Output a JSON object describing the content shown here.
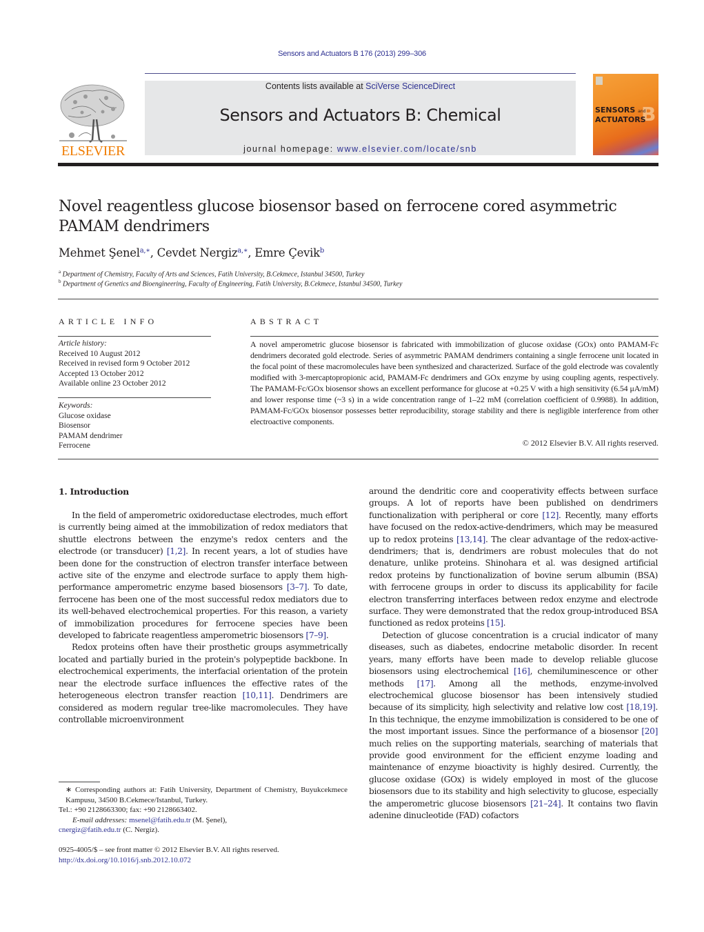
{
  "running_head": "Sensors and Actuators B 176 (2013) 299–306",
  "masthead": {
    "publisher_logo_text": "ELSEVIER",
    "contents_prefix": "Contents lists available at ",
    "contents_link": "SciVerse ScienceDirect",
    "journal_title": "Sensors and Actuators B: Chemical",
    "homepage_prefix": "journal homepage: ",
    "homepage_link": "www.elsevier.com/locate/snb",
    "cover_line1": "SENSORS",
    "cover_and": "and",
    "cover_line2": "ACTUATORS",
    "cover_letter": "B",
    "colors": {
      "publisher_orange": "#f07c00",
      "link_blue": "#2e3192",
      "masthead_gray": "#e6e7e8"
    }
  },
  "article": {
    "title": "Novel reagentless glucose biosensor based on ferrocene cored asymmetric PAMAM dendrimers",
    "authors": [
      {
        "name": "Mehmet Şenel",
        "sup": "a,∗",
        "sep": ", "
      },
      {
        "name": "Cevdet Nergiz",
        "sup": "a,∗",
        "sep": ", "
      },
      {
        "name": "Emre Çevik",
        "sup": "b",
        "sep": ""
      }
    ],
    "affiliations": [
      {
        "mark": "a",
        "text": "Department of Chemistry, Faculty of Arts and Sciences, Fatih University, B.Cekmece, Istanbul 34500, Turkey"
      },
      {
        "mark": "b",
        "text": "Department of Genetics and Bioengineering, Faculty of Engineering, Fatih University, B.Cekmece, Istanbul 34500, Turkey"
      }
    ]
  },
  "article_info": {
    "heading": "ARTICLE INFO",
    "history_label": "Article history:",
    "history": [
      "Received 10 August 2012",
      "Received in revised form 9 October 2012",
      "Accepted 13 October 2012",
      "Available online 23 October 2012"
    ],
    "keywords_label": "Keywords:",
    "keywords": [
      "Glucose oxidase",
      "Biosensor",
      "PAMAM dendrimer",
      "Ferrocene"
    ]
  },
  "abstract": {
    "heading": "ABSTRACT",
    "text": "A novel amperometric glucose biosensor is fabricated with immobilization of glucose oxidase (GOx) onto PAMAM-Fc dendrimers decorated gold electrode. Series of asymmetric PAMAM dendrimers containing a single ferrocene unit located in the focal point of these macromolecules have been synthesized and characterized. Surface of the gold electrode was covalently modified with 3-mercaptopropionic acid, PAMAM-Fc dendrimers and GOx enzyme by using coupling agents, respectively. The PAMAM-Fc/GOx biosensor shows an excellent performance for glucose at +0.25 V with a high sensitivity (6.54 μA/mM) and lower response time (~3 s) in a wide concentration range of 1–22 mM (correlation coefficient of 0.9988). In addition, PAMAM-Fc/GOx biosensor possesses better reproducibility, storage stability and there is negligible interference from other electroactive components.",
    "copyright": "© 2012 Elsevier B.V. All rights reserved."
  },
  "body": {
    "section_heading": "1.  Introduction",
    "left_paragraphs": [
      [
        {
          "t": "In the field of amperometric oxidoreductase electrodes, much effort is currently being aimed at the immobilization of redox mediators that shuttle electrons between the enzyme's redox centers and the electrode (or transducer) "
        },
        {
          "ref": "[1,2]"
        },
        {
          "t": ". In recent years, a lot of studies have been done for the construction of electron transfer interface between active site of the enzyme and electrode surface to apply them high-performance amperometric enzyme based biosensors "
        },
        {
          "ref": "[3–7]"
        },
        {
          "t": ". To date, ferrocene has been one of the most successful redox mediators due to its well-behaved electrochemical properties. For this reason, a variety of immobilization procedures for ferrocene species have been developed to fabricate reagentless amperometric biosensors "
        },
        {
          "ref": "[7–9]"
        },
        {
          "t": "."
        }
      ],
      [
        {
          "t": "Redox proteins often have their prosthetic groups asymmetrically located and partially buried in the protein's polypeptide backbone. In electrochemical experiments, the interfacial orientation of the protein near the electrode surface influences the effective rates of the heterogeneous electron transfer reaction "
        },
        {
          "ref": "[10,11]"
        },
        {
          "t": ". Dendrimers are considered as modern regular tree-like macromolecules. They have controllable microenvironment"
        }
      ]
    ],
    "right_paragraphs": [
      [
        {
          "t": "around the dendritic core and cooperativity effects between surface groups. A lot of reports have been published on dendrimers functionalization with peripheral or core "
        },
        {
          "ref": "[12]"
        },
        {
          "t": ". Recently, many efforts have focused on the redox-active-dendrimers, which may be measured up to redox proteins "
        },
        {
          "ref": "[13,14]"
        },
        {
          "t": ". The clear advantage of the redox-active-dendrimers; that is, dendrimers are robust molecules that do not denature, unlike proteins. Shinohara et al. was designed artificial redox proteins by functionalization of bovine serum albumin (BSA) with ferrocene groups in order to discuss its applicability for facile electron transferring interfaces between redox enzyme and electrode surface. They were demonstrated that the redox group-introduced BSA functioned as redox proteins "
        },
        {
          "ref": "[15]"
        },
        {
          "t": "."
        }
      ],
      [
        {
          "t": "Detection of glucose concentration is a crucial indicator of many diseases, such as diabetes, endocrine metabolic disorder. In recent years, many efforts have been made to develop reliable glucose biosensors using electrochemical "
        },
        {
          "ref": "[16]"
        },
        {
          "t": ", chemiluminescence or other methods "
        },
        {
          "ref": "[17]"
        },
        {
          "t": ". Among all the methods, enzyme-involved electrochemical glucose biosensor has been intensively studied because of its simplicity, high selectivity and relative low cost "
        },
        {
          "ref": "[18,19]"
        },
        {
          "t": ". In this technique, the enzyme immobilization is considered to be one of the most important issues. Since the performance of a biosensor "
        },
        {
          "ref": "[20]"
        },
        {
          "t": " much relies on the supporting materials, searching of materials that provide good environment for the efficient enzyme loading and maintenance of enzyme bioactivity is highly desired. Currently, the glucose oxidase (GOx) is widely employed in most of the glucose biosensors due to its stability and high selectivity to glucose, especially the amperometric glucose biosensors "
        },
        {
          "ref": "[21–24]"
        },
        {
          "t": ". It contains two flavin adenine dinucleotide (FAD) cofactors"
        }
      ]
    ]
  },
  "footnotes": {
    "corresponding": "∗ Corresponding authors at: Fatih University, Department of Chemistry, Buyukcekmece Kampusu, 34500 B.Cekmece/Istanbul, Turkey.",
    "tel": "Tel.: +90 2128663300; fax: +90 2128663402.",
    "email_label": "E-mail addresses:",
    "email1": "msenel@fatih.edu.tr",
    "email1_owner": " (M. Şenel),",
    "email2": "cnergiz@fatih.edu.tr",
    "email2_owner": " (C. Nergiz)."
  },
  "front_matter": {
    "issn_line": "0925-4005/$ – see front matter © 2012 Elsevier B.V. All rights reserved.",
    "doi": "http://dx.doi.org/10.1016/j.snb.2012.10.072"
  }
}
